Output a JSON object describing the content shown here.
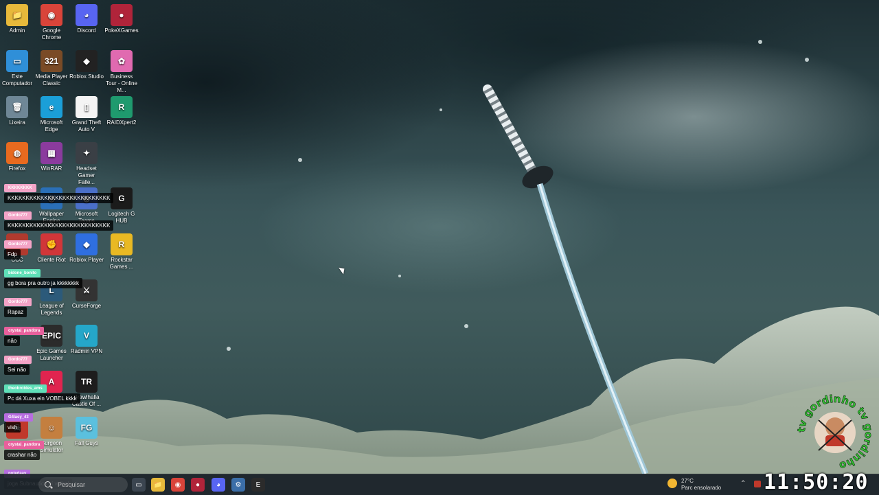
{
  "desktop": {
    "icons": [
      {
        "label": "Admin",
        "glyph": "📁",
        "color": "#e7b93b"
      },
      {
        "label": "Google Chrome",
        "glyph": "◉",
        "color": "#d9443a"
      },
      {
        "label": "Discord",
        "glyph": "◕",
        "color": "#5865f2"
      },
      {
        "label": "PokeXGames",
        "glyph": "●",
        "color": "#b0243a"
      },
      {
        "label": "Este Computador",
        "glyph": "▭",
        "color": "#2f8fd8"
      },
      {
        "label": "Media Player Classic",
        "glyph": "321",
        "color": "#7a4b26"
      },
      {
        "label": "Roblox Studio",
        "glyph": "◆",
        "color": "#222222"
      },
      {
        "label": "Business Tour - Online M...",
        "glyph": "✿",
        "color": "#e06ab0"
      },
      {
        "label": "Lixeira",
        "glyph": "🗑",
        "color": "#6f8796"
      },
      {
        "label": "Microsoft Edge",
        "glyph": "e",
        "color": "#1b9fd8"
      },
      {
        "label": "Grand Theft Auto V",
        "glyph": "▯",
        "color": "#f4f4f4"
      },
      {
        "label": "RAIDXpert2",
        "glyph": "R",
        "color": "#1f9a6e"
      },
      {
        "label": "Firefox",
        "glyph": "◍",
        "color": "#e86a1f"
      },
      {
        "label": "WinRAR",
        "glyph": "▦",
        "color": "#8b3b9e"
      },
      {
        "label": "Headset Gamer Falle...",
        "glyph": "✦",
        "color": "#3a3f45"
      },
      {
        "label": "Wallpaper Engine",
        "glyph": "◎",
        "color": "#2a6fb8"
      },
      {
        "label": "Microsoft Teams",
        "glyph": "◍",
        "color": "#4a6fc9"
      },
      {
        "label": "Logitech G HUB",
        "glyph": "G",
        "color": "#1b1b1b"
      },
      {
        "label": "CCC",
        "glyph": "◐",
        "color": "#b03a2e"
      },
      {
        "label": "Cliente Riot",
        "glyph": "✊",
        "color": "#d13639"
      },
      {
        "label": "Roblox Player",
        "glyph": "◆",
        "color": "#2f6fe0"
      },
      {
        "label": "Rockstar Games ...",
        "glyph": "R",
        "color": "#e9b923"
      },
      {
        "label": "League of Legends",
        "glyph": "L",
        "color": "#2c5a7a"
      },
      {
        "label": "CurseForge",
        "glyph": "⚔",
        "color": "#333333"
      },
      {
        "label": "Epic Games Launcher",
        "glyph": "EPIC",
        "color": "#2b2b2b"
      },
      {
        "label": "Radmin VPN",
        "glyph": "V",
        "color": "#25a7c9"
      },
      {
        "label": "",
        "glyph": "A",
        "color": "#e0244f"
      },
      {
        "label": "Brawlhalla Castle Of ...",
        "glyph": "TR",
        "color": "#1d1d1d"
      },
      {
        "label": "",
        "glyph": "☠",
        "color": "#c0392b"
      },
      {
        "label": "Surgeon Simulator",
        "glyph": "☺",
        "color": "#c47f3f"
      },
      {
        "label": "Fall Guys",
        "glyph": "FG",
        "color": "#5bc0de"
      }
    ]
  },
  "chat": [
    {
      "user": "KKKKKKKK",
      "text": "KKKKKKKKKKKKKKKKKKKKKKKKKKKK",
      "color": "#f3a3c6"
    },
    {
      "user": "Gordo777",
      "text": "KKKKKKKKKKKKKKKKKKKKKKKKKKKK",
      "color": "#f3a3c6"
    },
    {
      "user": "Gordo777",
      "text": "Fdp",
      "color": "#f3a3c6"
    },
    {
      "user": "bidone_bonito",
      "text": "gg bora pra outro ja kkkkkkkk",
      "color": "#5fe0b8"
    },
    {
      "user": "Gordo777",
      "text": "Rapaz",
      "color": "#f3a3c6"
    },
    {
      "user": "crystal_pandora",
      "text": "não",
      "color": "#e8609c"
    },
    {
      "user": "Gordo777",
      "text": "Sei não",
      "color": "#f3a3c6"
    },
    {
      "user": "theobrobles_ams",
      "text": "Pc dá Xuxa ein VOBEL kkkk",
      "color": "#5fe0b8"
    },
    {
      "user": "G4lasy_43",
      "text": "vish",
      "color": "#b76de0"
    },
    {
      "user": "crystal_pandora",
      "text": "crashar não",
      "color": "#e8609c"
    },
    {
      "user": "notedaay",
      "text": "joga Subnautica aí volbel",
      "color": "#b76de0"
    }
  ],
  "watermark": {
    "text": "tv gordinho tv gordinho"
  },
  "taskbar": {
    "search_placeholder": "Pesquisar",
    "apps": [
      {
        "name": "task-view",
        "glyph": "▭",
        "color": "#3b4550"
      },
      {
        "name": "file-explorer",
        "glyph": "📁",
        "color": "#e7b93b"
      },
      {
        "name": "chrome",
        "glyph": "◉",
        "color": "#d9443a"
      },
      {
        "name": "pokexgames",
        "glyph": "●",
        "color": "#b0243a"
      },
      {
        "name": "discord",
        "glyph": "◕",
        "color": "#5865f2"
      },
      {
        "name": "settings",
        "glyph": "⚙",
        "color": "#3b6ea8"
      },
      {
        "name": "epic-games",
        "glyph": "E",
        "color": "#2b2b2b"
      }
    ],
    "weather": {
      "temp": "27°C",
      "desc": "Parc ensolarado"
    },
    "tray_chevron": "⌃",
    "clock": "11:50:20"
  }
}
